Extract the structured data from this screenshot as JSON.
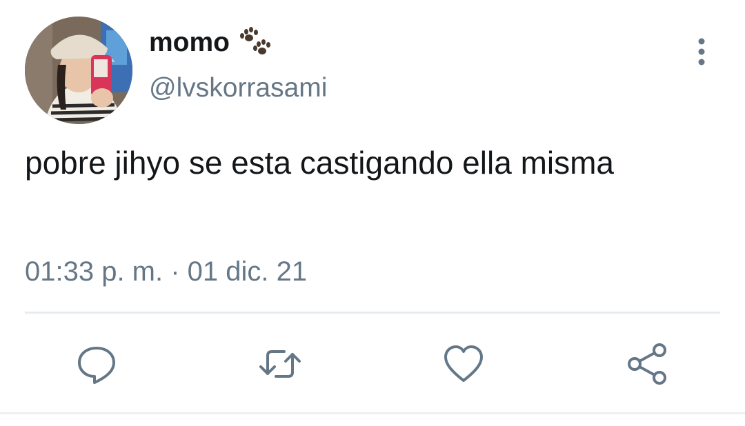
{
  "tweet": {
    "author": {
      "display_name": "momo",
      "handle": "@lvskorrasami",
      "name_emoji_icon": "paw-prints-icon"
    },
    "text": "pobre jihyo se esta castigando ella misma",
    "timestamp": "01:33 p. m. · 01 dic. 21"
  },
  "menu": {
    "icon": "more-vertical-icon"
  },
  "actions": [
    {
      "name": "reply",
      "icon": "reply-icon"
    },
    {
      "name": "retweet",
      "icon": "retweet-icon"
    },
    {
      "name": "like",
      "icon": "heart-icon"
    },
    {
      "name": "share",
      "icon": "share-icon"
    }
  ],
  "colors": {
    "text_primary": "#14171a",
    "text_secondary": "#657786",
    "icon": "#657786",
    "divider": "#e6ecf0",
    "background": "#ffffff"
  }
}
